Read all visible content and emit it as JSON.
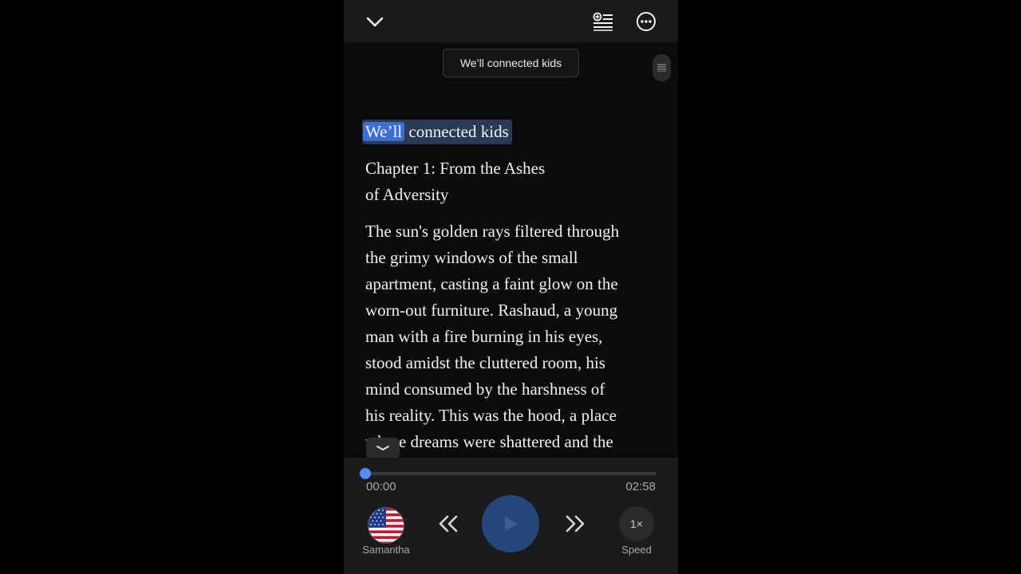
{
  "header": {
    "title_pill": "We’ll connected kids"
  },
  "document": {
    "heading_highlighted": "We’ll",
    "heading_rest": " connected kids",
    "chapter_line1": "Chapter 1: From the Ashes",
    "chapter_line2": "of Adversity",
    "body_lines": [
      "The sun's golden rays filtered through",
      "the grimy windows of the small",
      "apartment, casting a faint glow on the",
      "worn-out furniture. Rashaud, a young",
      "man with a fire burning in his eyes,",
      "stood amidst the cluttered room, his",
      "mind consumed by the harshness of",
      "his reality. This was the hood, a place",
      "where dreams were shattered and the"
    ]
  },
  "player": {
    "elapsed": "00:00",
    "total": "02:58",
    "progress": 0.0,
    "voice_label": "Samantha",
    "speed_value": "1×",
    "speed_label": "Speed"
  },
  "icons": {
    "collapse": "chevron-down-icon",
    "playlist": "playlist-add-icon",
    "more": "more-circle-icon",
    "rewind": "rewind-icon",
    "play": "play-icon",
    "forward": "fast-forward-icon",
    "voice": "us-flag-icon"
  },
  "colors": {
    "accent": "#4e8ef7",
    "highlight": "#3c6fd4",
    "play_button": "#25477a"
  }
}
